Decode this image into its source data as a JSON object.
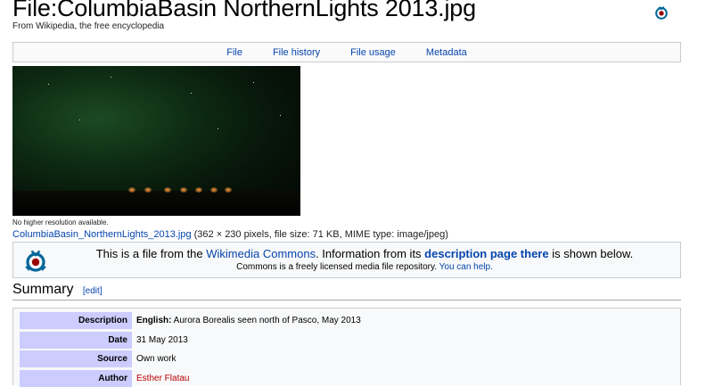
{
  "page": {
    "title": "File:ColumbiaBasin NorthernLights 2013.jpg",
    "tagline": "From Wikipedia, the free encyclopedia"
  },
  "tabs": [
    "File",
    "File history",
    "File usage",
    "Metadata"
  ],
  "file": {
    "no_higher": "No higher resolution available.",
    "filename_link": "ColumbiaBasin_NorthernLights_2013.jpg",
    "details": "(362 × 230 pixels, file size: 71 KB, MIME type: image/jpeg)"
  },
  "commons_notice": {
    "line1_prefix": "This is a file from the ",
    "line1_link": "Wikimedia Commons",
    "line1_middle": ". Information from its ",
    "line1_bold_link": "description page there",
    "line1_suffix": " is shown below.",
    "line2_text": "Commons is a freely licensed media file repository. ",
    "line2_link": "You can help."
  },
  "summary": {
    "heading": "Summary",
    "edit_label": "[edit]",
    "rows": [
      {
        "label": "Description",
        "value_bold": "English:",
        "value": " Aurora Borealis seen north of Pasco, May 2013"
      },
      {
        "label": "Date",
        "value": "31 May 2013"
      },
      {
        "label": "Source",
        "value": "Own work"
      },
      {
        "label": "Author",
        "value_link": "Esther Flatau"
      }
    ]
  },
  "icons": {
    "commons_top": "commons-logo-icon",
    "commons_box": "commons-logo-icon"
  },
  "colors": {
    "link": "#0645ad",
    "red_link": "#ba0000",
    "infobox_label_bg": "#ccccff",
    "commons_blue": "#069",
    "commons_red": "#900"
  }
}
